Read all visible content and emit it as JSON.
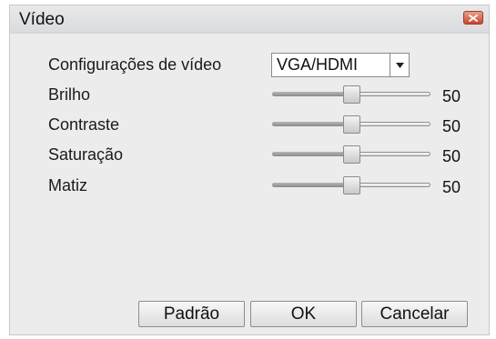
{
  "window": {
    "title": "Vídeo"
  },
  "video_config": {
    "label": "Configurações de vídeo",
    "selected": "VGA/HDMI"
  },
  "sliders": [
    {
      "label": "Brilho",
      "value": "50",
      "level": 0.5
    },
    {
      "label": "Contraste",
      "value": "50",
      "level": 0.5
    },
    {
      "label": "Saturação",
      "value": "50",
      "level": 0.5
    },
    {
      "label": "Matiz",
      "value": "50",
      "level": 0.5
    }
  ],
  "buttons": {
    "default": "Padrão",
    "ok": "OK",
    "cancel": "Cancelar"
  },
  "colors": {
    "close_button": "#c8472b",
    "dialog_bg": "#ececec"
  }
}
